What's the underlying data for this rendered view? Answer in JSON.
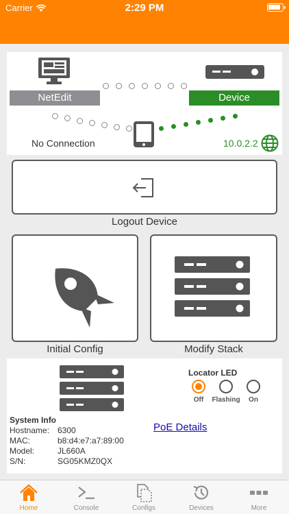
{
  "status_bar": {
    "carrier": "Carrier",
    "time": "2:29 PM"
  },
  "connection": {
    "netedit_label": "NetEdit",
    "device_label": "Device",
    "status_text": "No Connection",
    "ip_address": "10.0.2.2"
  },
  "actions": {
    "logout_label": "Logout Device",
    "initial_config_label": "Initial Config",
    "modify_stack_label": "Modify Stack"
  },
  "system_info": {
    "title": "System Info",
    "rows": [
      {
        "key": "Hostname:",
        "value": "6300"
      },
      {
        "key": "MAC:",
        "value": "b8:d4:e7:a7:89:00"
      },
      {
        "key": "Model:",
        "value": "JL660A"
      },
      {
        "key": "S/N:",
        "value": "SG05KMZ0QX"
      }
    ],
    "poe_link": "PoE Details"
  },
  "locator_led": {
    "title": "Locator LED",
    "options": [
      "Off",
      "Flashing",
      "On"
    ],
    "selected": "Off"
  },
  "tabs": [
    {
      "label": "Home",
      "icon": "home-icon",
      "active": true
    },
    {
      "label": "Console",
      "icon": "terminal-icon",
      "active": false
    },
    {
      "label": "Configs",
      "icon": "configs-icon",
      "active": false
    },
    {
      "label": "Devices",
      "icon": "history-icon",
      "active": false
    },
    {
      "label": "More",
      "icon": "more-icon",
      "active": false
    }
  ],
  "colors": {
    "accent": "#ff8300",
    "success": "#2a8d27",
    "inactive": "#8e8e93"
  }
}
